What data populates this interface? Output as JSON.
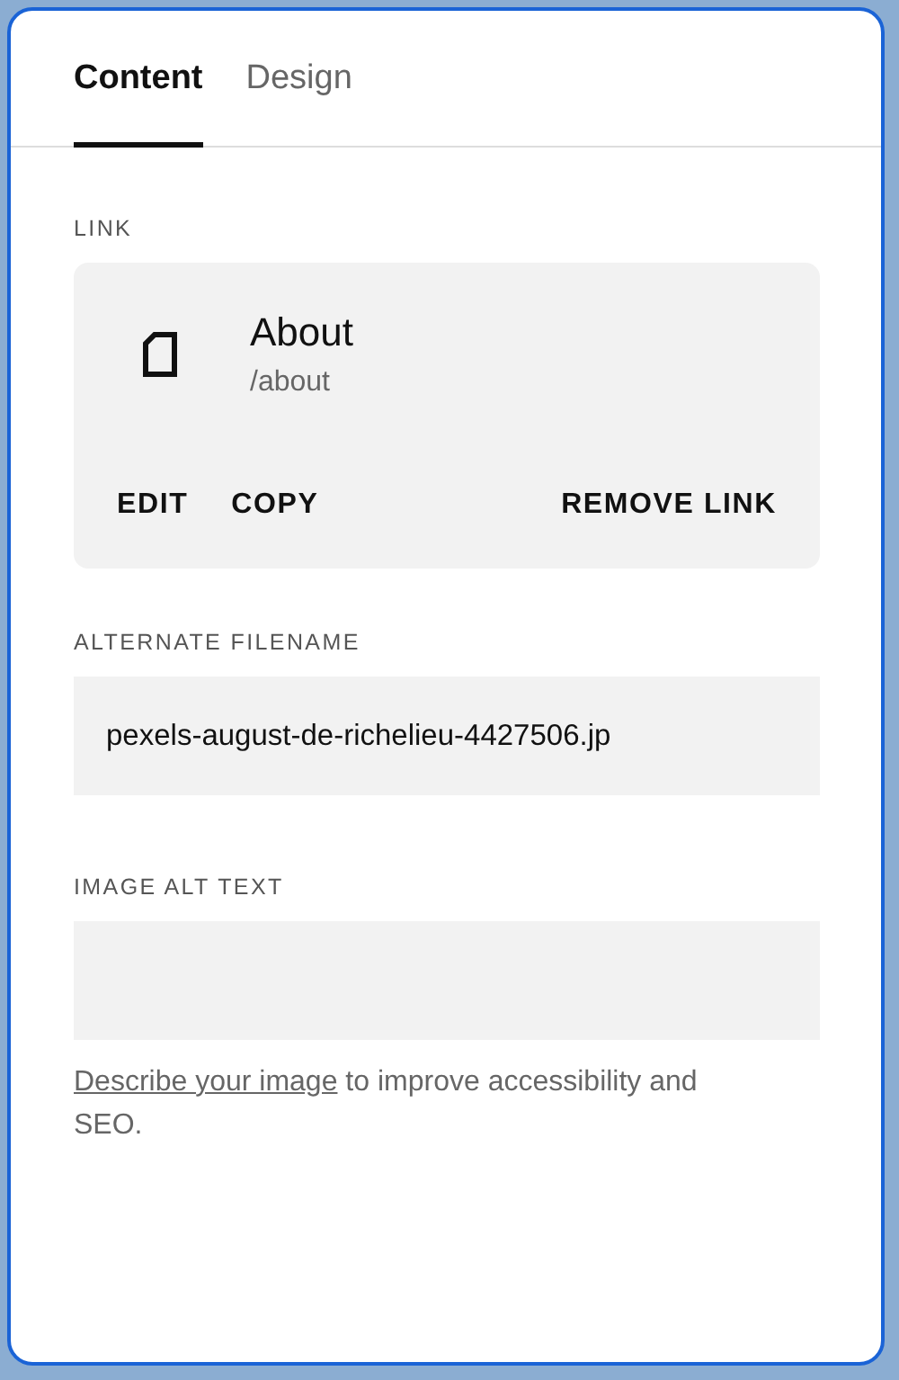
{
  "tabs": [
    {
      "label": "Content",
      "selected": true
    },
    {
      "label": "Design",
      "selected": false
    }
  ],
  "link": {
    "label": "LINK",
    "title": "About",
    "path": "/about",
    "actions": [
      "EDIT",
      "COPY",
      "REMOVE LINK"
    ]
  },
  "alternate_filename": {
    "label": "ALTERNATE FILENAME",
    "value": "pexels-august-de-richelieu-4427506.jp"
  },
  "image_alt_text": {
    "label": "IMAGE ALT TEXT"
  },
  "help": {
    "link": "Describe your image",
    "text": " to improve accessibility and SEO."
  }
}
